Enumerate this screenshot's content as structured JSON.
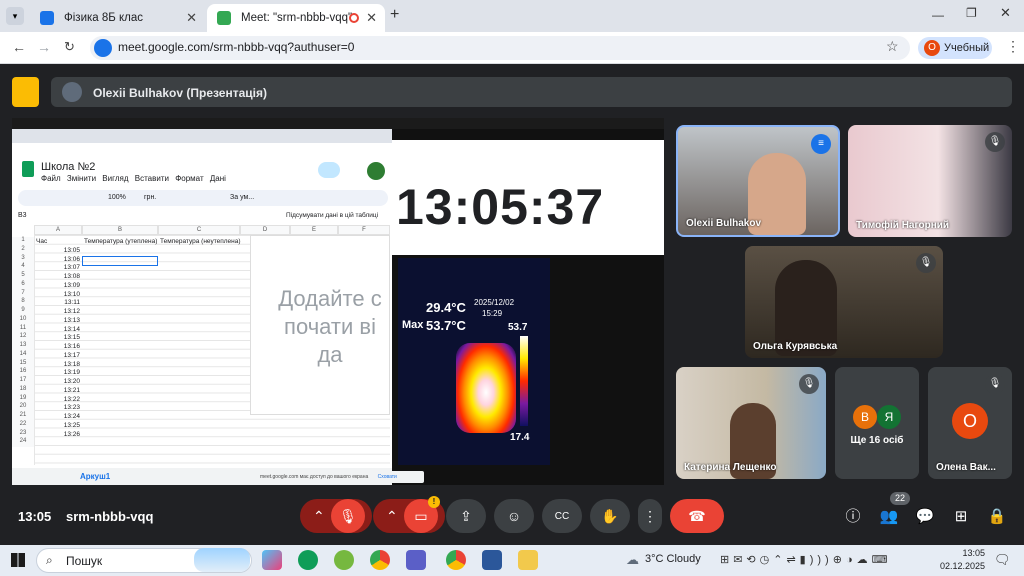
{
  "browser": {
    "tabs": [
      {
        "title": "Фізика 8Б клас",
        "active": false,
        "color": "#1a73e8"
      },
      {
        "title": "Meet: \"srm-nbbb-vqq\"",
        "active": true,
        "color": "#34a853"
      }
    ],
    "url": "meet.google.com/srm-nbbb-vqq?authuser=0",
    "profile_initial": "О",
    "profile_label": "Учебный"
  },
  "meet": {
    "presenter_banner": "Olexii Bulhakov (Презентація)",
    "time": "13:05",
    "meeting_code": "srm-nbbb-vqq",
    "participants_count": "22",
    "more_people": "Ще 16 осіб",
    "more_initials": [
      "В",
      "Я"
    ],
    "tiles": [
      {
        "name": "Olexii Bulhakov",
        "muted": false
      },
      {
        "name": "Тимофій Нагорний",
        "muted": true
      },
      {
        "name": "Ольга Курявська",
        "muted": true
      },
      {
        "name": "Катерина Лещенко",
        "muted": true
      },
      {
        "name": "Олена Вак...",
        "initial": "О",
        "muted": true
      }
    ]
  },
  "shared": {
    "doc_title": "Школа №2",
    "menu": [
      "Файл",
      "Змінити",
      "Вигляд",
      "Вставити",
      "Формат",
      "Дані"
    ],
    "toolbar_zoom": "100%",
    "toolbar_currency": "грн.",
    "toolbar_font": "За ум...",
    "cell_ref": "B3",
    "summarize": "Підсумувати дані в цій таблиці",
    "columns": [
      "A",
      "B",
      "C",
      "D",
      "E",
      "F"
    ],
    "header_row": [
      "Час",
      "Температура (утеплена)",
      "Температура (неутеплена)"
    ],
    "times": [
      "13:05",
      "13:06",
      "13:07",
      "13:08",
      "13:09",
      "13:10",
      "13:11",
      "13:12",
      "13:13",
      "13:14",
      "13:15",
      "13:16",
      "13:17",
      "13:18",
      "13:19",
      "13:20",
      "13:21",
      "13:22",
      "13:23",
      "13:24",
      "13:25",
      "13:26"
    ],
    "placeholder": "Додайте с\nпочати ві\nда",
    "sheet_tab": "Аркуш1",
    "clock": "13:05:37",
    "thermal": {
      "center_temp": "29.4°C",
      "max_label": "Max",
      "max_temp": "53.7°C",
      "date": "2025/12/02",
      "time": "15:29",
      "scale_max": "53.7",
      "scale_min": "17.4"
    },
    "share_notice": "meet.google.com має доступ до вашого екрана",
    "share_hide": "Сховати"
  },
  "taskbar": {
    "search": "Пошук",
    "weather": "3°C  Cloudy",
    "time": "13:05",
    "date": "02.12.2025"
  }
}
